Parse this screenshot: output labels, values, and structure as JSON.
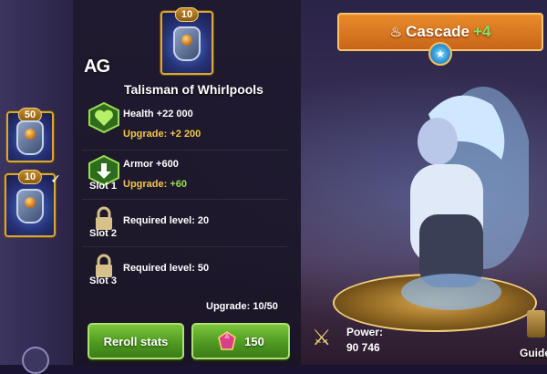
{
  "item": {
    "name": "Talisman of Whirlpools",
    "level_badge": "10",
    "logo_text": "AG"
  },
  "side_items": [
    {
      "badge": "50"
    },
    {
      "badge": "10"
    }
  ],
  "slots": {
    "slot1": {
      "label": "Slot 1",
      "stats": [
        {
          "text": "Health +22 000",
          "upgrade": "Upgrade:",
          "upgrade_value": "+2 200"
        },
        {
          "text": "Armor +600",
          "upgrade": "Upgrade:",
          "upgrade_value": "+60"
        }
      ]
    },
    "slot2": {
      "label": "Slot 2",
      "required": "Required level: 20"
    },
    "slot3": {
      "label": "Slot 3",
      "required": "Required level: 50"
    }
  },
  "upgrade_count": "Upgrade: 10/50",
  "buttons": {
    "reroll": "Reroll stats",
    "cost": "150"
  },
  "hero": {
    "name": "Cascade",
    "plus": "+4"
  },
  "power": {
    "label": "Power:",
    "value": "90 746"
  },
  "guide": "Guide",
  "colors": {
    "accent_orange": "#e98c2a",
    "button_green": "#4f9a22",
    "gold": "#d9a63a"
  }
}
